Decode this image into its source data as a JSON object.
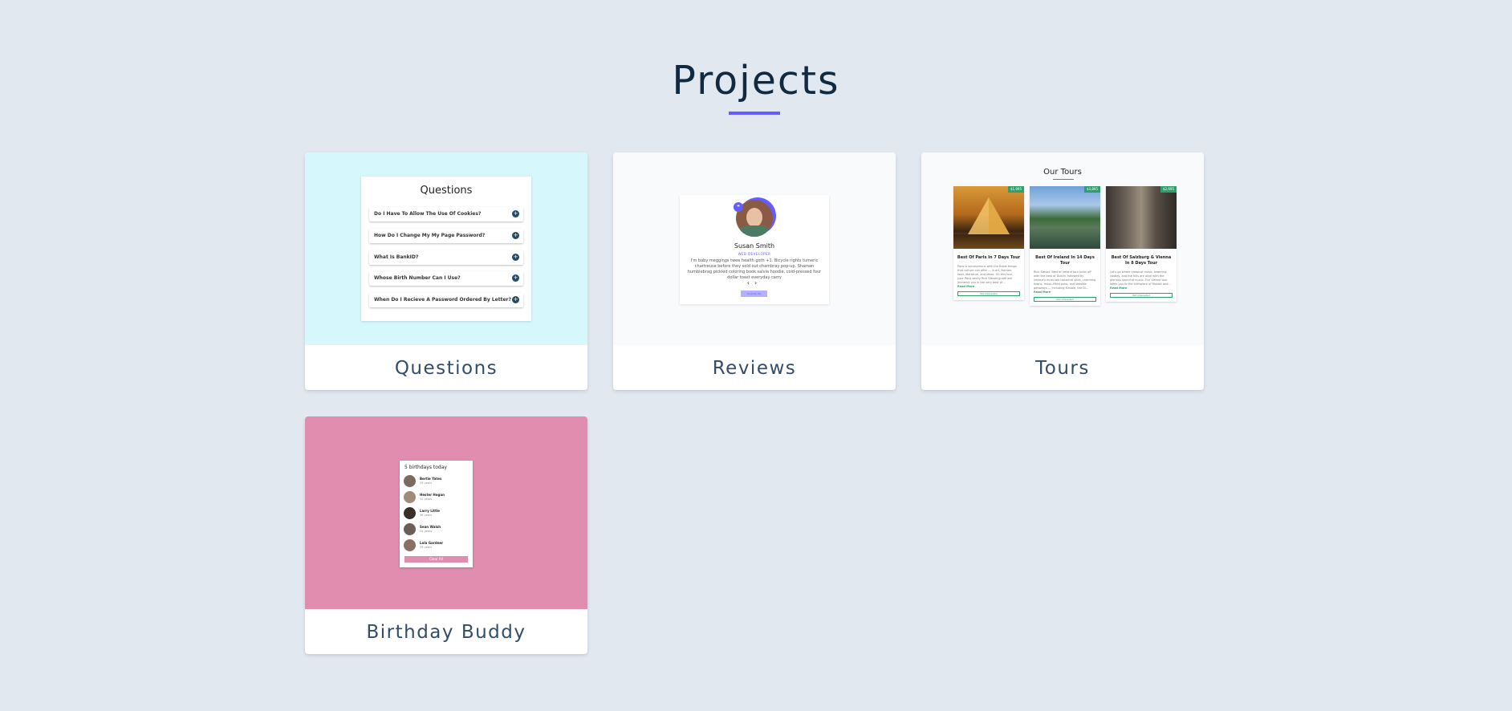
{
  "page": {
    "title": "Projects"
  },
  "colors": {
    "background": "#e2e8f0",
    "accent": "#645cff",
    "questions_bg": "#d6f8fd",
    "birthday_bg": "#e18db0",
    "tours_green": "#2c9f6b"
  },
  "projects": [
    {
      "label": "Questions",
      "preview": {
        "title": "Questions",
        "items": [
          "Do I Have To Allow The Use Of Cookies?",
          "How Do I Change My My Page Password?",
          "What Is BankID?",
          "Whose Birth Number Can I Use?",
          "When Do I Recieve A Password Ordered By Letter?"
        ],
        "icon": "plus-icon"
      }
    },
    {
      "label": "Reviews",
      "preview": {
        "name": "Susan Smith",
        "job": "WEB DEVELOPER",
        "text": "I'm baby meggings twee health goth +1. Bicycle rights tumeric chartreuse before they sold out chambray pop-up. Shaman humblebrag pickled coloring book salvia hoodie, cold-pressed four dollar toast everyday carry",
        "prev": "‹",
        "next": "›",
        "button": "Surprise Me"
      }
    },
    {
      "label": "Tours",
      "preview": {
        "title": "Our Tours",
        "tours": [
          {
            "name": "Best Of Paris In 7 Days Tour",
            "price": "$1,995",
            "desc": "Paris is synonymous with the finest things that culture can offer — in art, fashion, food, literature, and ideas. On this tour, your Paris-savvy Rick Steves guide will immerse you in the very best of ...",
            "more": "Read More",
            "button": "Not Interested"
          },
          {
            "name": "Best Of Ireland In 14 Days Tour",
            "price": "$3,895",
            "desc": "Rick Steves' Best of Ireland tour kicks off with the best of Dublin, followed by Ireland's must-see historical sites, charming towns, music-filled pubs, and seaside getaways — including Kinsale, the Di...",
            "more": "Read More",
            "button": "Not Interested"
          },
          {
            "name": "Best Of Salzburg & Vienna In 8 Days Tour",
            "price": "$2,695",
            "desc": "Let's go where classical music, towering castles, and the hills are alive with the glorious sound of music. Our Vienna tour takes you to the birthplace of Mozart and...",
            "more": "Read More",
            "button": "Not Interested"
          }
        ]
      }
    },
    {
      "label": "Birthday Buddy",
      "preview": {
        "title": "5 birthdays today",
        "people": [
          {
            "name": "Bertie Yates",
            "age": "29 years"
          },
          {
            "name": "Hester Hogan",
            "age": "32 years"
          },
          {
            "name": "Larry Little",
            "age": "36 years"
          },
          {
            "name": "Sean Walsh",
            "age": "34 years"
          },
          {
            "name": "Lola Gardner",
            "age": "29 years"
          }
        ],
        "button": "Clear All"
      }
    }
  ]
}
